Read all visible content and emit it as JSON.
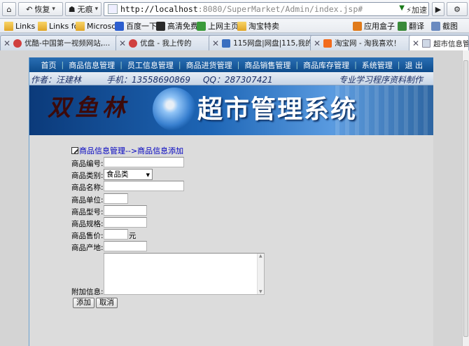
{
  "browser": {
    "back_label": "恢复",
    "mode_label": "无痕",
    "url_host": "http://localhost",
    "url_rest": ":8080/SuperMarket/Admin/index.jsp#",
    "accel_label": "加速",
    "bookmarks": [
      {
        "label": "Links"
      },
      {
        "label": "Links fo"
      },
      {
        "label": "Microso"
      },
      {
        "label": "百度一下"
      },
      {
        "label": "高清免费"
      },
      {
        "label": "上网主页"
      },
      {
        "label": "淘宝特卖"
      },
      {
        "label": "应用盒子"
      },
      {
        "label": "翻译"
      },
      {
        "label": "截图"
      }
    ],
    "tabs": [
      {
        "label": "优酷-中国第一视频网站,..."
      },
      {
        "label": "优盘 - 我上传的"
      },
      {
        "label": "115网盘|网盘|115,我的..."
      },
      {
        "label": "淘宝网 - 淘我喜欢！"
      },
      {
        "label": "超市信息管理"
      }
    ]
  },
  "site": {
    "nav": [
      "首页",
      "商品信息管理",
      "员工信息管理",
      "商品进货管理",
      "商品销售管理",
      "商品库存管理",
      "系统管理",
      "退 出"
    ],
    "banner": {
      "author": "作者：汪建林",
      "phone": "手机：13558690869",
      "qq": "QQ：287307421",
      "slogan": "专业学习程序资料制作",
      "logo_left": "双鱼林",
      "logo_right": "超市管理系统"
    },
    "form": {
      "breadcrumb": "商品信息管理-->商品信息添加",
      "labels": {
        "code": "商品编号:",
        "category": "商品类别:",
        "name": "商品名称:",
        "unit": "商品单位:",
        "model": "商品型号:",
        "spec": "商品规格:",
        "price": "商品售价:",
        "origin": "商品产地:",
        "extra": "附加信息:"
      },
      "category_value": "食品类",
      "price_unit": "元",
      "add_label": "添加",
      "cancel_label": "取消"
    }
  }
}
